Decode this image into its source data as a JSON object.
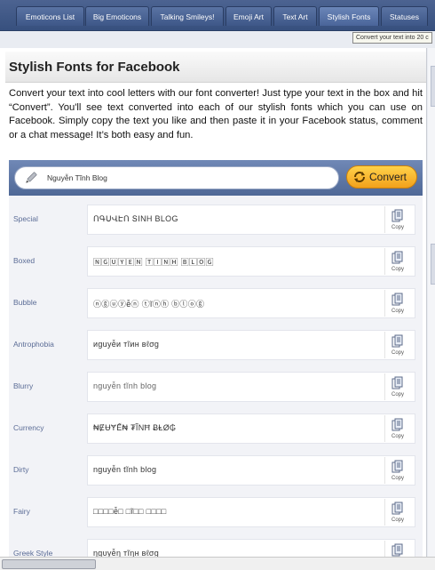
{
  "tabs": [
    {
      "label": "Emoticons List"
    },
    {
      "label": "Big Emoticons"
    },
    {
      "label": "Talking Smileys!"
    },
    {
      "label": "Emoji Art"
    },
    {
      "label": "Text Art"
    },
    {
      "label": "Stylish Fonts"
    },
    {
      "label": "Statuses"
    }
  ],
  "tooltip": "Convert your text into 20 c",
  "page": {
    "title": "Stylish Fonts for Facebook",
    "intro": "Convert your text into cool letters with our font converter! Just type your text in the box and hit “Convert”. You'll see text converted into each of our stylish fonts which you can use on Facebook. Simply copy the text you like and then paste it in your Facebook status, comment or a chat message! It’s both easy and fun."
  },
  "converter": {
    "input_value": "Nguyễn Tĩnh Blog",
    "button_label": "Convert",
    "copy_label": "Copy",
    "fonts": [
      {
        "name": "Special",
        "text": "ՈԳՍՎԷՈ ՏΙΝΗ ΒLOG"
      },
      {
        "name": "Boxed",
        "text": "🄽🄶🅄🅈🄴🄽 🅃🄸🄽🄷 🄱🄻🄾🄶"
      },
      {
        "name": "Bubble",
        "text": "ⓝⓖⓤⓨễⓝ ⓣĩⓝⓗ ⓑⓛⓞⓖ"
      },
      {
        "name": "Antrophobia",
        "text": "иguуễи тĩин вℓσg"
      },
      {
        "name": "Blurry",
        "text": "nguyễn tĩnh blog"
      },
      {
        "name": "Currency",
        "text": "₦ɆɄɎẾ₦ ₮ĨΝĦ ɃⱠØ₲"
      },
      {
        "name": "Dirty",
        "text": "nguyễn tĩnh blog"
      },
      {
        "name": "Fairy",
        "text": "□□□□ễ□ □ĩ□□ □□□□"
      },
      {
        "name": "Greek Style",
        "text": "ηgυуễη тĩηн вℓσg"
      }
    ]
  },
  "colors": {
    "tab_bar": "#3e5788",
    "converter_header": "#5f78a6",
    "convert_button": "#f7b52e",
    "font_label": "#5b6c96"
  }
}
